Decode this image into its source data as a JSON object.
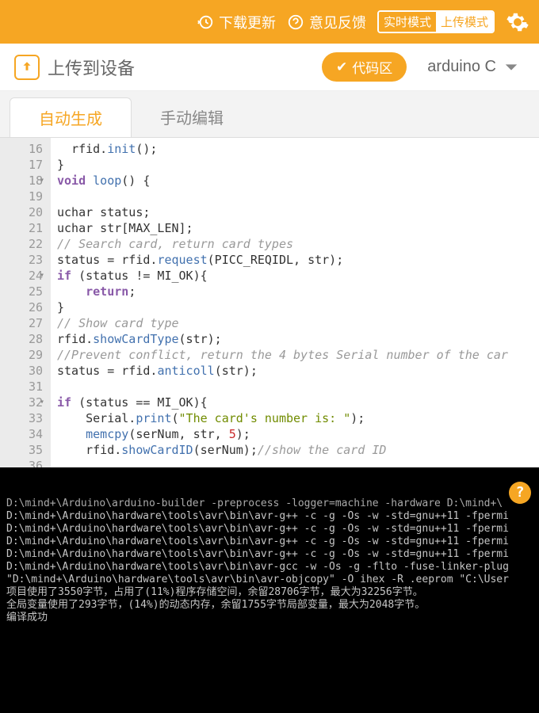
{
  "topbar": {
    "download_label": "下载更新",
    "feedback_label": "意见反馈",
    "realtime_mode": "实时模式",
    "upload_mode": "上传模式"
  },
  "subbar": {
    "upload_device_label": "上传到设备",
    "code_area_label": "代码区",
    "language": "arduino C"
  },
  "tabs": {
    "auto": "自动生成",
    "manual": "手动编辑"
  },
  "gutter_start": 16,
  "code_lines": [
    {
      "ind": 1,
      "tokens": [
        {
          "t": "rfid.",
          "c": ""
        },
        {
          "t": "init",
          "c": "fn"
        },
        {
          "t": "();",
          "c": ""
        }
      ]
    },
    {
      "ind": 0,
      "tokens": [
        {
          "t": "}",
          "c": ""
        }
      ]
    },
    {
      "ind": 0,
      "fold": true,
      "tokens": [
        {
          "t": "void",
          "c": "kw"
        },
        {
          "t": " ",
          "c": ""
        },
        {
          "t": "loop",
          "c": "fn"
        },
        {
          "t": "() {",
          "c": ""
        }
      ]
    },
    {
      "ind": 0,
      "tokens": []
    },
    {
      "ind": 0,
      "tokens": [
        {
          "t": "uchar status;",
          "c": ""
        }
      ]
    },
    {
      "ind": 0,
      "tokens": [
        {
          "t": "uchar str[MAX_LEN];",
          "c": ""
        }
      ]
    },
    {
      "ind": 0,
      "tokens": [
        {
          "t": "// Search card, return card types",
          "c": "cm"
        }
      ]
    },
    {
      "ind": 0,
      "tokens": [
        {
          "t": "status = rfid.",
          "c": ""
        },
        {
          "t": "request",
          "c": "fn"
        },
        {
          "t": "(PICC_REQIDL, str);",
          "c": ""
        }
      ]
    },
    {
      "ind": 0,
      "fold": true,
      "tokens": [
        {
          "t": "if",
          "c": "kw"
        },
        {
          "t": " (status != MI_OK){",
          "c": ""
        }
      ]
    },
    {
      "ind": 2,
      "tokens": [
        {
          "t": "return",
          "c": "ret"
        },
        {
          "t": ";",
          "c": ""
        }
      ]
    },
    {
      "ind": 0,
      "tokens": [
        {
          "t": "}",
          "c": ""
        }
      ]
    },
    {
      "ind": 0,
      "tokens": [
        {
          "t": "// Show card type",
          "c": "cm"
        }
      ]
    },
    {
      "ind": 0,
      "tokens": [
        {
          "t": "rfid.",
          "c": ""
        },
        {
          "t": "showCardType",
          "c": "fn"
        },
        {
          "t": "(str);",
          "c": ""
        }
      ]
    },
    {
      "ind": 0,
      "tokens": [
        {
          "t": "//Prevent conflict, return the 4 bytes Serial number of the car",
          "c": "cm"
        }
      ]
    },
    {
      "ind": 0,
      "tokens": [
        {
          "t": "status = rfid.",
          "c": ""
        },
        {
          "t": "anticoll",
          "c": "fn"
        },
        {
          "t": "(str);",
          "c": ""
        }
      ]
    },
    {
      "ind": 0,
      "tokens": []
    },
    {
      "ind": 0,
      "fold": true,
      "tokens": [
        {
          "t": "if",
          "c": "kw"
        },
        {
          "t": " (status == MI_OK){",
          "c": ""
        }
      ]
    },
    {
      "ind": 2,
      "tokens": [
        {
          "t": "Serial.",
          "c": ""
        },
        {
          "t": "print",
          "c": "fn"
        },
        {
          "t": "(",
          "c": ""
        },
        {
          "t": "\"The card's number is: \"",
          "c": "str"
        },
        {
          "t": ");",
          "c": ""
        }
      ]
    },
    {
      "ind": 2,
      "tokens": [
        {
          "t": "memcpy",
          "c": "fn"
        },
        {
          "t": "(serNum, str, ",
          "c": ""
        },
        {
          "t": "5",
          "c": "num"
        },
        {
          "t": ");",
          "c": ""
        }
      ]
    },
    {
      "ind": 2,
      "tokens": [
        {
          "t": "rfid.",
          "c": ""
        },
        {
          "t": "showCardID",
          "c": "fn"
        },
        {
          "t": "(serNum);",
          "c": ""
        },
        {
          "t": "//show the card ID",
          "c": "cm"
        }
      ]
    },
    {
      "ind": 2,
      "tokens": []
    }
  ],
  "console_lines": [
    "D:\\mind+\\Arduino\\arduino-builder -preprocess -logger=machine -hardware D:\\mind+\\",
    "D:\\mind+\\Arduino\\hardware\\tools\\avr\\bin\\avr-g++ -c -g -Os -w -std=gnu++11 -fpermi",
    "D:\\mind+\\Arduino\\hardware\\tools\\avr\\bin\\avr-g++ -c -g -Os -w -std=gnu++11 -fpermi",
    "D:\\mind+\\Arduino\\hardware\\tools\\avr\\bin\\avr-g++ -c -g -Os -w -std=gnu++11 -fpermi",
    "D:\\mind+\\Arduino\\hardware\\tools\\avr\\bin\\avr-g++ -c -g -Os -w -std=gnu++11 -fpermi",
    "D:\\mind+\\Arduino\\hardware\\tools\\avr\\bin\\avr-gcc -w -Os -g -flto -fuse-linker-plug",
    "\"D:\\mind+\\Arduino\\hardware\\tools\\avr\\bin\\avr-objcopy\" -O ihex -R .eeprom \"C:\\User",
    "项目使用了3550字节，占用了(11%)程序存储空间，余留28706字节，最大为32256字节。",
    "全局变量使用了293字节，(14%)的动态内存，余留1755字节局部变量，最大为2048字节。",
    "编译成功"
  ],
  "help_badge": "?"
}
